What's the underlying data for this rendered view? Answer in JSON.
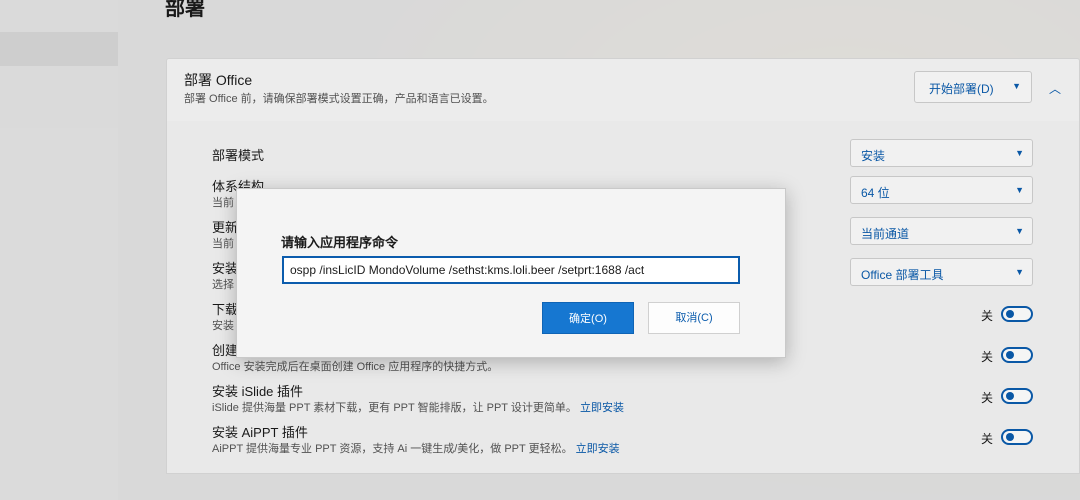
{
  "page": {
    "title": "部署"
  },
  "deploy_card": {
    "title": "部署 Office",
    "subtitle": "部署 Office 前，请确保部署模式设置正确，产品和语言已设置。",
    "start_button": "开始部署(D)"
  },
  "settings": [
    {
      "label": "部署模式",
      "desc": "",
      "control": "dropdown",
      "value": "安装"
    },
    {
      "label": "体系结构",
      "desc": "当前",
      "control": "dropdown",
      "value": "64 位"
    },
    {
      "label": "更新",
      "desc": "当前",
      "control": "dropdown",
      "value": "当前通道"
    },
    {
      "label": "安装",
      "desc": "选择",
      "control": "dropdown",
      "value": "Office 部署工具"
    },
    {
      "label": "下载",
      "desc": "安装",
      "control": "toggle",
      "value": "关"
    },
    {
      "label": "创建",
      "desc": "Office 安装完成后在桌面创建 Office 应用程序的快捷方式。",
      "control": "toggle",
      "value": "关"
    },
    {
      "label": "安装 iSlide 插件",
      "desc": "iSlide 提供海量 PPT 素材下载，更有 PPT 智能排版，让 PPT 设计更简单。",
      "link": "立即安装",
      "control": "toggle",
      "value": "关"
    },
    {
      "label": "安装 AiPPT 插件",
      "desc": "AiPPT 提供海量专业 PPT 资源，支持 Ai 一键生成/美化，做 PPT 更轻松。",
      "link": "立即安装",
      "control": "toggle",
      "value": "关"
    }
  ],
  "dialog": {
    "title": "请输入应用程序命令",
    "input_value": "ospp /insLicID MondoVolume /sethst:kms.loli.beer /setprt:1688 /act",
    "ok_label": "确定(O)",
    "cancel_label": "取消(C)"
  },
  "colors": {
    "accent": "#0b5cad",
    "primary_button": "#1677d1"
  }
}
